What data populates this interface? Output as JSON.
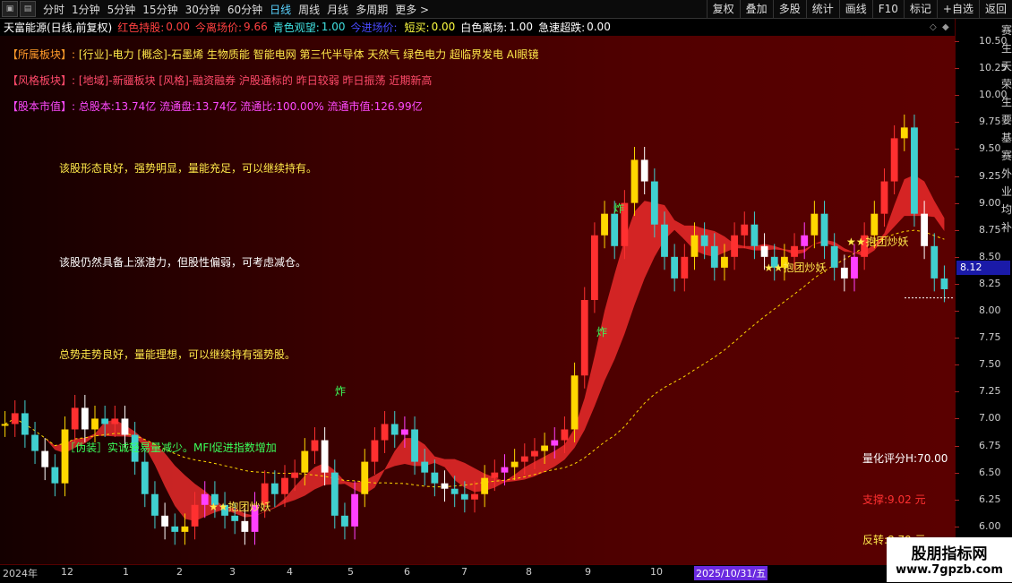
{
  "toolbar": {
    "periods": [
      "分时",
      "1分钟",
      "5分钟",
      "15分钟",
      "30分钟",
      "60分钟",
      "日线",
      "周线",
      "月线",
      "多周期",
      "更多 >"
    ],
    "active_period": "日线",
    "right_buttons": [
      "复权",
      "叠加",
      "多股",
      "统计",
      "画线",
      "F10",
      "标记",
      "+自选",
      "返回"
    ]
  },
  "infobar": {
    "title": "天富能源(日线,前复权)",
    "items": [
      {
        "label": "红色持股:",
        "value": "0.00",
        "color": "#ff4040"
      },
      {
        "label": "今离场价:",
        "value": "9.66",
        "color": "#ff4040"
      },
      {
        "label": "青色观望:",
        "value": "1.00",
        "color": "#40e0e0"
      },
      {
        "label": "今进场价:",
        "value": "",
        "color": "#4040ff"
      },
      {
        "label": "短买:",
        "value": "0.00",
        "color": "#ffff40"
      },
      {
        "label": "白色离场:",
        "value": "1.00",
        "color": "#ffffff"
      },
      {
        "label": "急速超跌:",
        "value": "0.00",
        "color": "#ffffff"
      }
    ]
  },
  "sections": {
    "industry": {
      "label": "【所属板块】:",
      "text": "[行业]-电力 [概念]-石墨烯 生物质能 智能电网 第三代半导体 天然气 绿色电力 超临界发电 AI眼镜"
    },
    "style": {
      "label": "【风格板块】:",
      "text": "[地域]-新疆板块 [风格]-融资融券 沪股通标的 昨日较弱 昨日振荡 近期新高"
    },
    "capital": {
      "label": "【股本市值】:",
      "text": "总股本:13.74亿 流通盘:13.74亿 流通比:100.00% 流通市值:126.99亿"
    }
  },
  "comments": [
    "该股形态良好，强势明显，量能充足，可以继续持有。",
    "该股仍然具备上涨潜力，但股性偏弱，可考虑减仓。",
    "总势走势良好，量能理想，可以继续持有强势股。"
  ],
  "signals": {
    "fake": "［伪装］实诚轻易量减少。MFI促进指数增加",
    "hug1": "★★抱团炒妖",
    "hug2": "★★抱团炒妖",
    "hug3": "★★抱团炒妖",
    "bomb": "炸"
  },
  "score": {
    "quant": "量化评分H:70.00",
    "support": "支撑:9.02 元",
    "resist": "反转:8.79 元"
  },
  "yaxis": {
    "ticks": [
      "10.50",
      "10.25",
      "10.00",
      "9.75",
      "9.50",
      "9.25",
      "9.00",
      "8.75",
      "8.50",
      "8.25",
      "8.00",
      "7.75",
      "7.50",
      "7.25",
      "7.00",
      "6.75",
      "6.50",
      "6.25",
      "6.00",
      "5.75"
    ],
    "current": "8.12"
  },
  "xaxis": {
    "labels": [
      "2024年",
      "12",
      "1",
      "2",
      "3",
      "4",
      "5",
      "6",
      "7",
      "8",
      "9",
      "10",
      "2025/10/31/五"
    ]
  },
  "right_strip": "赛生天荣生要基赛外业均补",
  "watermark": {
    "line1": "股朋指标网",
    "line2": "www.7gpzb.com"
  },
  "colors": {
    "accent": "#5ad3ff",
    "up": "#ff3030",
    "down": "#40d0d0",
    "yellow": "#ffd700"
  },
  "chart_data": {
    "type": "candlestick",
    "x_start": "2024年",
    "x_end": "2025/10/31/五",
    "ylim": [
      5.65,
      10.55
    ],
    "last_close": 8.12,
    "closes": [
      6.95,
      7.05,
      6.85,
      6.7,
      6.55,
      6.4,
      6.9,
      7.1,
      6.9,
      7.0,
      6.95,
      7.0,
      6.85,
      6.6,
      6.3,
      6.1,
      6.0,
      5.95,
      6.0,
      6.2,
      6.3,
      6.2,
      6.1,
      6.05,
      5.95,
      6.2,
      6.4,
      6.3,
      6.45,
      6.5,
      6.7,
      6.8,
      6.5,
      6.1,
      6.0,
      6.3,
      6.6,
      6.8,
      6.95,
      6.85,
      6.9,
      6.6,
      6.5,
      6.4,
      6.35,
      6.3,
      6.25,
      6.3,
      6.45,
      6.5,
      6.55,
      6.6,
      6.65,
      6.7,
      6.75,
      6.8,
      6.9,
      7.4,
      8.1,
      8.7,
      8.9,
      8.6,
      9.0,
      9.4,
      9.2,
      8.8,
      8.5,
      8.3,
      8.5,
      8.7,
      8.6,
      8.4,
      8.5,
      8.7,
      8.8,
      8.6,
      8.5,
      8.4,
      8.5,
      8.6,
      8.7,
      8.9,
      8.6,
      8.4,
      8.3,
      8.5,
      8.7,
      8.9,
      9.2,
      9.6,
      9.7,
      8.9,
      8.6,
      8.3,
      8.2
    ]
  }
}
